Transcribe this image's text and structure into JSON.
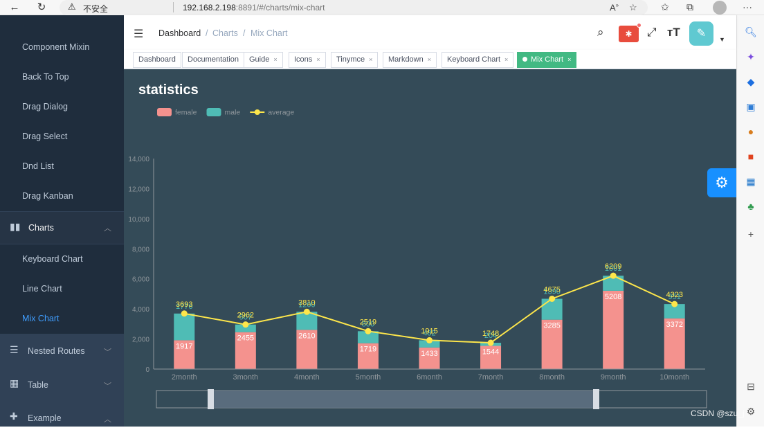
{
  "browser": {
    "back_icon": "arrow-left-icon",
    "refresh_icon": "refresh-icon",
    "insecure_label": "不安全",
    "url_host": "192.168.2.198",
    "url_rest": ":8891/#/charts/mix-chart"
  },
  "sidebar": {
    "items_top": [
      {
        "label": "Component Mixin"
      },
      {
        "label": "Back To Top"
      },
      {
        "label": "Drag Dialog"
      },
      {
        "label": "Drag Select"
      },
      {
        "label": "Dnd List"
      },
      {
        "label": "Drag Kanban"
      }
    ],
    "charts_group": "Charts",
    "charts_items": [
      {
        "label": "Keyboard Chart"
      },
      {
        "label": "Line Chart"
      },
      {
        "label": "Mix Chart"
      }
    ],
    "nested_routes": "Nested Routes",
    "table": "Table",
    "example": "Example"
  },
  "navbar": {
    "breadcrumb": [
      "Dashboard",
      "Charts",
      "Mix Chart"
    ],
    "sep": "/"
  },
  "tags": [
    {
      "label": "Dashboard"
    },
    {
      "label": "Documentation"
    },
    {
      "label": "Guide"
    },
    {
      "label": "Icons"
    },
    {
      "label": "Tinymce"
    },
    {
      "label": "Markdown"
    },
    {
      "label": "Keyboard Chart"
    },
    {
      "label": "Mix Chart"
    }
  ],
  "tag_close": "×",
  "watermark": "CSDN @szu_j",
  "colors": {
    "female": "#f4928e",
    "male": "#4fbcb5",
    "average": "#fde64b",
    "panel_bg": "#344b58",
    "active_tag": "#42b983"
  },
  "chart_data": {
    "type": "bar",
    "title": "statistics",
    "legend": [
      "female",
      "male",
      "average"
    ],
    "legend_position": "top-left",
    "categories": [
      "2month",
      "3month",
      "4month",
      "5month",
      "6month",
      "7month",
      "8month",
      "9month",
      "10month"
    ],
    "series": [
      {
        "name": "female",
        "type": "bar",
        "stack": "total",
        "values": [
          1917,
          2455,
          2610,
          1719,
          1433,
          1544,
          3285,
          5208,
          3372
        ]
      },
      {
        "name": "male",
        "type": "bar",
        "stack": "total",
        "values": [
          1776,
          507,
          1200,
          800,
          482,
          204,
          1390,
          1001,
          951
        ]
      },
      {
        "name": "average",
        "type": "line",
        "values": [
          3693,
          2962,
          3810,
          2519,
          1915,
          1748,
          4675,
          6209,
          4323
        ]
      }
    ],
    "y_axis": {
      "min": 0,
      "max": 14000,
      "ticks": [
        "0",
        "2,000",
        "4,000",
        "6,000",
        "8,000",
        "10,000",
        "12,000",
        "14,000"
      ]
    },
    "grid": false,
    "datazoom_slider": true
  }
}
